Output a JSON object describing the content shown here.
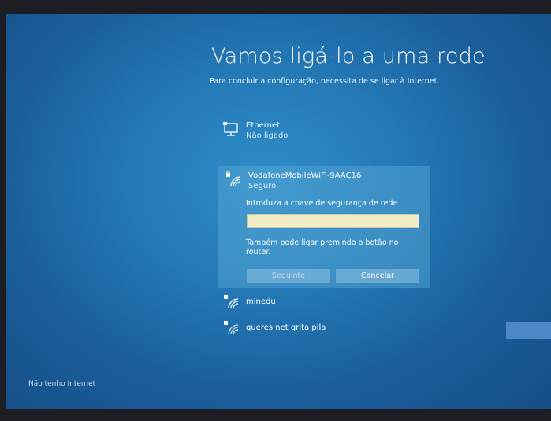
{
  "page": {
    "title": "Vamos ligá-lo a uma rede",
    "subtitle": "Para concluir a configuração, necessita de se ligar à Internet."
  },
  "networks": {
    "ethernet": {
      "name": "Ethernet",
      "status": "Não ligado",
      "icon": "ethernet-icon"
    },
    "selected": {
      "name": "VodafoneMobileWiFi-9AAC16",
      "status": "Seguro",
      "icon": "wifi-secure-icon",
      "key_label": "Introduza a chave de segurança de rede",
      "key_value": "",
      "hint": "Também pode ligar premindo o botão no router.",
      "next_label": "Seguinte",
      "cancel_label": "Cancelar"
    },
    "others": [
      {
        "name": "minedu",
        "icon": "wifi-secure-icon"
      },
      {
        "name": "queres net grita pila",
        "icon": "wifi-secure-icon"
      }
    ]
  },
  "footer": {
    "no_internet_label": "Não tenho Internet"
  },
  "colors": {
    "background": "#2478b6",
    "selected_panel": "#5aaad7",
    "input_bg": "#f3ecc8",
    "side_button": "#4f86c9"
  }
}
